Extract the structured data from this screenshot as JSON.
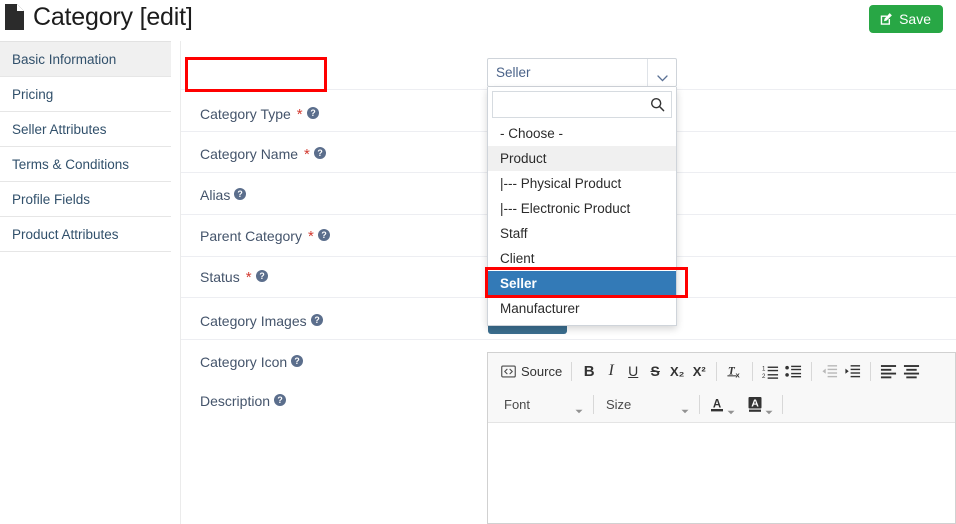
{
  "header": {
    "title": "Category [edit]",
    "doc_icon": "document-icon",
    "save_label": "Save",
    "save_icon": "edit-square-icon",
    "save_color": "#28a745"
  },
  "sidebar": {
    "items": [
      {
        "label": "Basic Information",
        "active": true
      },
      {
        "label": "Pricing",
        "active": false
      },
      {
        "label": "Seller Attributes",
        "active": false
      },
      {
        "label": "Terms & Conditions",
        "active": false
      },
      {
        "label": "Profile Fields",
        "active": false
      },
      {
        "label": "Product Attributes",
        "active": false
      }
    ]
  },
  "form": {
    "rows": [
      {
        "label": "Category Type",
        "required": true,
        "help": true
      },
      {
        "label": "Category Name",
        "required": true,
        "help": true
      },
      {
        "label": "Alias",
        "required": false,
        "help": true
      },
      {
        "label": "Parent Category",
        "required": true,
        "help": true
      },
      {
        "label": "Status",
        "required": true,
        "help": true
      },
      {
        "label": "Category Images",
        "required": false,
        "help": true
      },
      {
        "label": "Category Icon",
        "required": false,
        "help": true
      },
      {
        "label": "Description",
        "required": false,
        "help": true
      }
    ],
    "required_marker": "*"
  },
  "category_type_select": {
    "selected_value": "Seller",
    "chevron_icon": "chevron-down-icon",
    "search_placeholder": "",
    "search_value": "",
    "search_icon": "search-icon",
    "options": [
      {
        "label": "- Choose -",
        "state": "normal"
      },
      {
        "label": "Product",
        "state": "hover"
      },
      {
        "label": "|--- Physical Product",
        "state": "normal"
      },
      {
        "label": "|--- Electronic Product",
        "state": "normal"
      },
      {
        "label": "Staff",
        "state": "normal"
      },
      {
        "label": "Client",
        "state": "normal"
      },
      {
        "label": "Seller",
        "state": "selected"
      },
      {
        "label": "Manufacturer",
        "state": "normal"
      }
    ],
    "selected_highlight_color": "#337ab7"
  },
  "annotations": {
    "highlight_color": "#ff0000",
    "boxes": [
      {
        "name": "category-type-label-highlight"
      },
      {
        "name": "seller-option-highlight"
      }
    ]
  },
  "editor": {
    "toolbar_row1": [
      {
        "label": "Source",
        "icon": "source-icon",
        "type": "text-button"
      },
      {
        "label": "B",
        "icon": "bold-icon",
        "type": "icon"
      },
      {
        "label": "I",
        "icon": "italic-icon",
        "type": "icon"
      },
      {
        "label": "U",
        "icon": "underline-icon",
        "type": "icon"
      },
      {
        "label": "S",
        "icon": "strikethrough-icon",
        "type": "icon"
      },
      {
        "label": "X₂",
        "icon": "subscript-icon",
        "type": "icon"
      },
      {
        "label": "X²",
        "icon": "superscript-icon",
        "type": "icon"
      },
      {
        "label": "Tx",
        "icon": "remove-format-icon",
        "type": "icon"
      },
      {
        "label": "Numbered List",
        "icon": "numbered-list-icon",
        "type": "icon"
      },
      {
        "label": "Bulleted List",
        "icon": "bulleted-list-icon",
        "type": "icon"
      },
      {
        "label": "Decrease Indent",
        "icon": "outdent-icon",
        "type": "icon",
        "disabled": true
      },
      {
        "label": "Increase Indent",
        "icon": "indent-icon",
        "type": "icon"
      },
      {
        "label": "Align Left",
        "icon": "align-left-icon",
        "type": "icon"
      },
      {
        "label": "Align Center",
        "icon": "align-center-icon",
        "type": "icon"
      }
    ],
    "font_label": "Font",
    "size_label": "Size",
    "text_color_icon": "text-color-icon",
    "bg_color_icon": "background-color-icon",
    "body_text": ""
  }
}
